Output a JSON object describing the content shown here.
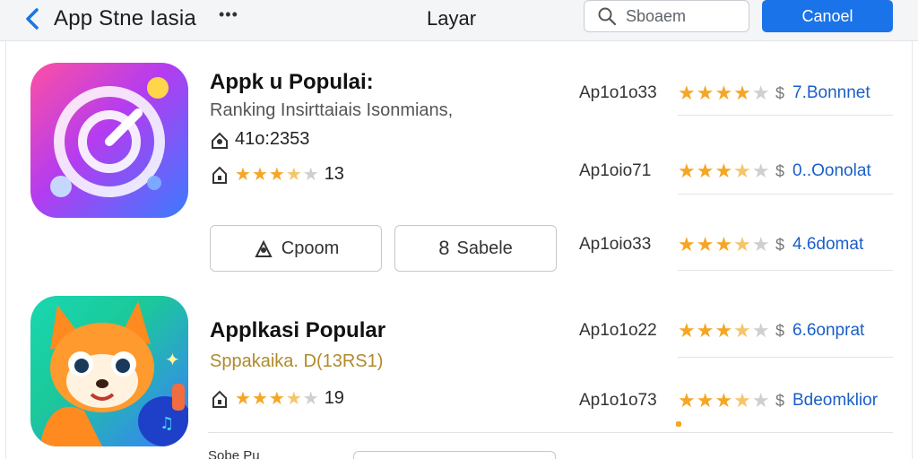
{
  "header": {
    "back_icon": "chevron-left-icon",
    "title": "App Stne Iasia",
    "more_icon": "ellipsis-icon",
    "center_title": "Layar",
    "search_placeholder": "Sboaem",
    "cancel_label": "Canoel"
  },
  "apps": [
    {
      "name": "Appk u Populai:",
      "subtitle": "Ranking Insirttaiais Isonmians,",
      "downloads": "41o:2353",
      "rating_count": "13",
      "rating": 3.5,
      "icon": "gradient-target-icon",
      "buttons": [
        {
          "label": "Cpoom",
          "icon": "person-icon"
        },
        {
          "label": "Sabele",
          "icon": "bookmark-icon",
          "prefix": "8"
        }
      ]
    },
    {
      "name": "Applkasi Popular",
      "subtitle": "Sppakaika. D(13RS1)",
      "rating_count": "19",
      "rating": 3.5,
      "icon": "fox-mascot-icon"
    }
  ],
  "list": [
    {
      "code": "Ap1o1o33",
      "rating": 4,
      "currency": "$",
      "price": "7.Bonnnet"
    },
    {
      "code": "Ap1oio71",
      "rating": 3.5,
      "currency": "$",
      "price": "0..Oonolat"
    },
    {
      "code": "Ap1oio33",
      "rating": 3.5,
      "currency": "$",
      "price": "4.6domat"
    },
    {
      "code": "Ap1o1o22",
      "rating": 3.5,
      "currency": "$",
      "price": "6.6onprat"
    },
    {
      "code": "Ap1o1o73",
      "rating": 3.5,
      "currency": "$",
      "price": "Bdeomklior"
    }
  ],
  "bottom_peek": "Sobe Pu",
  "colors": {
    "accent": "#1a73e8",
    "star": "#f5a623",
    "price": "#1a5fc8"
  }
}
